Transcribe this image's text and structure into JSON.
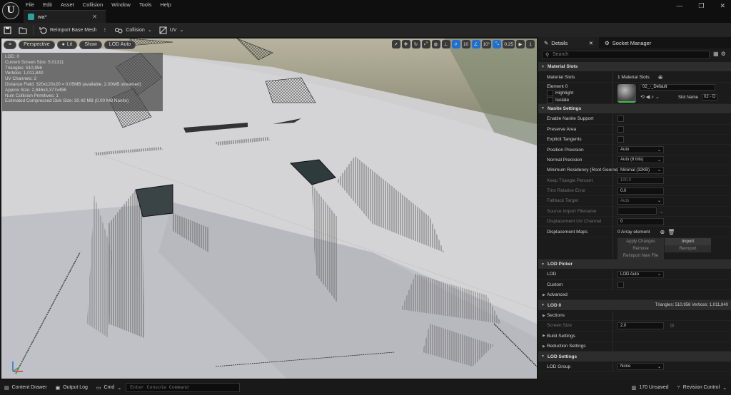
{
  "menu": [
    "File",
    "Edit",
    "Asset",
    "Collision",
    "Window",
    "Tools",
    "Help"
  ],
  "tab": {
    "title": "wa*"
  },
  "window_controls": {
    "minimize": "—",
    "restore": "❐",
    "close": "✕"
  },
  "toolbar": {
    "reimport": "Reimport Base Mesh",
    "collision": "Collision",
    "uv": "UV"
  },
  "viewport": {
    "menu_icon": "≡",
    "perspective": "Perspective",
    "lit": "Lit",
    "show": "Show",
    "lod_auto": "LOD Auto",
    "grid_value": "10",
    "angle_value": "10°",
    "scale_value": "0.25",
    "camera_value": "1",
    "stats": [
      "LOD: 0",
      "Current Screen Size: 5.01311",
      "Triangles: 510,956",
      "Vertices: 1,011,840",
      "UV Channels: 2",
      "Distance Field: 320x120x20 = 0.05MB (available, 2.00MB streamed)",
      "Approx Size: 2,846x3,377x456",
      "Num Collision Primitives: 1",
      "Estimated Compressed Disk Size: 30.42 MB (0.00 MB Nanite)"
    ]
  },
  "panel": {
    "details_tab": "Details",
    "socket_tab": "Socket Manager",
    "search_placeholder": "Search",
    "material_slots": {
      "header": "Material Slots",
      "label": "Material Slots",
      "value": "1 Material Slots",
      "element": "Element 0",
      "highlight": "Highlight",
      "isolate": "Isolate",
      "material_name": "02_-_Default",
      "slot_name_label": "Slot Name",
      "slot_name_value": "02 - D"
    },
    "nanite": {
      "header": "Nanite Settings",
      "enable": "Enable Nanite Support",
      "preserve": "Preserve Area",
      "explicit": "Explicit Tangents",
      "position_precision": "Position Precision",
      "position_precision_value": "Auto",
      "normal_precision": "Normal Precision",
      "normal_precision_value": "Auto (8 bits)",
      "min_residency": "Minimum Residency (Root Geome",
      "min_residency_value": "Minimal (32KB)",
      "keep_triangle": "Keep Triangle Percent",
      "keep_triangle_value": "100.0",
      "trim_error": "Trim Relative Error",
      "trim_error_value": "0.0",
      "fallback": "Fallback Target",
      "fallback_value": "Auto",
      "source_import": "Source Import Filename",
      "source_import_btn": "...",
      "displacement_uv": "Displacement UV Channel",
      "displacement_uv_value": "0",
      "displacement_maps": "Displacement Maps",
      "displacement_maps_value": "0 Array element",
      "apply_changes": "Apply Changes",
      "import": "Import",
      "remove": "Remove",
      "reimport": "Reimport",
      "reimport_new": "Reimport New File"
    },
    "lod_picker": {
      "header": "LOD Picker",
      "lod": "LOD",
      "lod_value": "LOD Auto",
      "custom": "Custom",
      "advanced": "Advanced"
    },
    "lod0": {
      "header": "LOD 0",
      "triangles": "Triangles: 510,956",
      "vertices": "Vertices: 1,011,840",
      "sections": "Sections",
      "screen_size": "Screen Size",
      "screen_size_value": "2.0",
      "build_settings": "Build Settings",
      "reduction_settings": "Reduction Settings"
    },
    "lod_settings": {
      "header": "LOD Settings",
      "lod_group": "LOD Group",
      "lod_group_value": "None"
    }
  },
  "bottom": {
    "content_drawer": "Content Drawer",
    "output_log": "Output Log",
    "cmd": "Cmd",
    "console_placeholder": "Enter Console Command",
    "unsaved": "170 Unsaved",
    "revision": "Revision Control"
  }
}
